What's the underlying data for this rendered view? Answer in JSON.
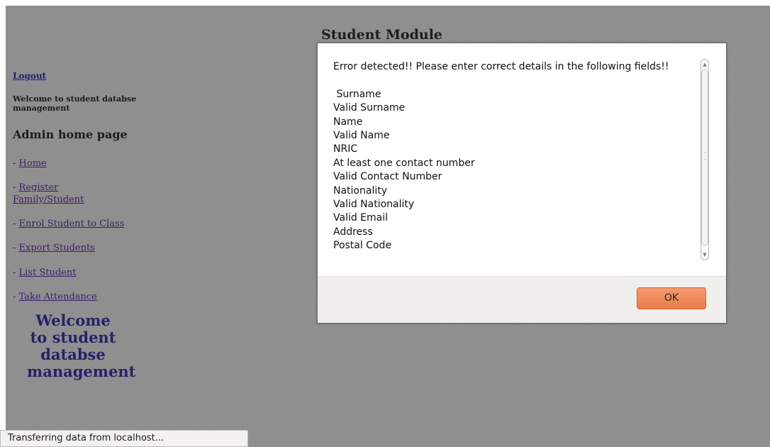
{
  "page": {
    "title": "Student Module"
  },
  "sidebar": {
    "logout": "Logout",
    "welcome_small": "Welcome to student databse management",
    "heading": "Admin home page",
    "nav_prefix": "- ",
    "items": [
      {
        "label": "Home"
      },
      {
        "label": "Register Family/Student"
      },
      {
        "label": "Enrol Student to Class"
      },
      {
        "label": "Export Students"
      },
      {
        "label": "List Student"
      },
      {
        "label": "Take Attendance"
      }
    ],
    "welcome_big": "Welcome to student databse management"
  },
  "dialog": {
    "message": "Error detected!! Please enter correct details in the following fields!!\n\n Surname\nValid Surname\nName\nValid Name\nNRIC\nAt least one contact number\nValid Contact Number\nNationality\nValid Nationality\nValid Email\nAddress\nPostal Code",
    "ok_label": "OK",
    "scroll_up_glyph": "▲",
    "scroll_down_glyph": "▼"
  },
  "statusbar": {
    "text": "Transferring data from localhost..."
  },
  "colors": {
    "overlay_gray": "#8e8e8e",
    "link": "#3c1f6a",
    "welcome_text": "#23236a",
    "ok_button": "#ee8a5b"
  }
}
